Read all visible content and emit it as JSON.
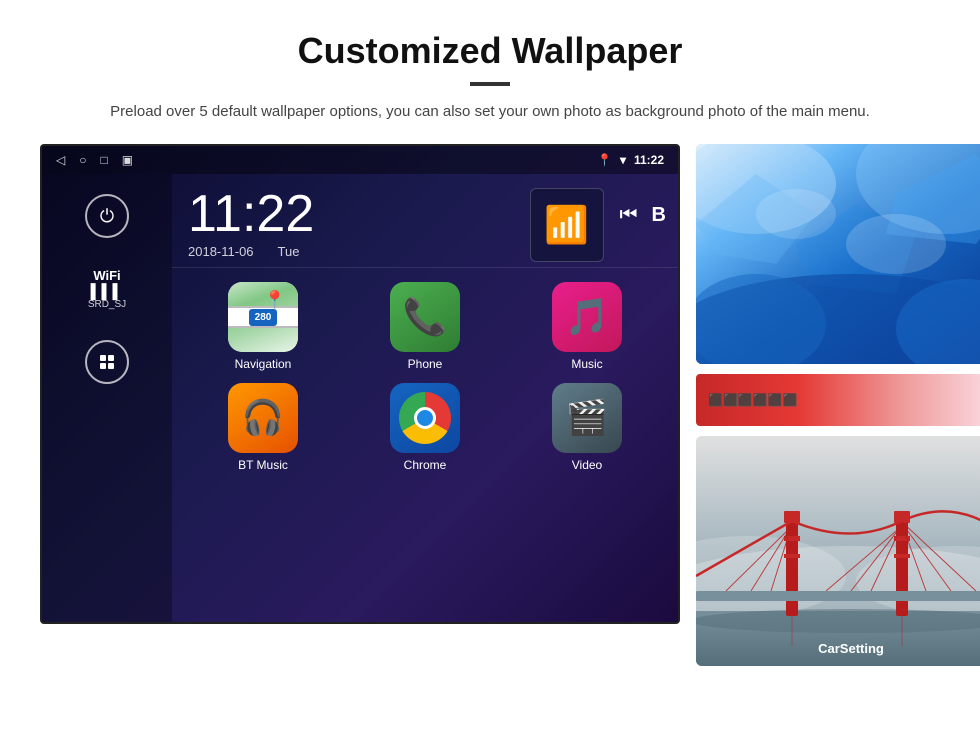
{
  "header": {
    "title": "Customized Wallpaper",
    "divider": true,
    "subtitle": "Preload over 5 default wallpaper options, you can also set your own photo as background photo of the main menu."
  },
  "android": {
    "statusBar": {
      "navBack": "◁",
      "navHome": "○",
      "navRecent": "□",
      "navCapture": "▣",
      "locationIcon": "📍",
      "wifiIcon": "▾",
      "time": "11:22"
    },
    "clock": {
      "time": "11:22",
      "date": "2018-11-06",
      "day": "Tue"
    },
    "sidebar": {
      "powerLabel": "⏻",
      "wifiLabel": "WiFi",
      "wifiBars": "▌▌▌",
      "wifiName": "SRD_SJ",
      "appsLabel": "⊞"
    },
    "apps": [
      {
        "name": "Navigation",
        "type": "navigation"
      },
      {
        "name": "Phone",
        "type": "phone"
      },
      {
        "name": "Music",
        "type": "music"
      },
      {
        "name": "BT Music",
        "type": "btmusic"
      },
      {
        "name": "Chrome",
        "type": "chrome"
      },
      {
        "name": "Video",
        "type": "video"
      }
    ],
    "mediaIcon": "wifi-signal",
    "mediaControls": {
      "prev": "⏮",
      "trackLabel": "B"
    }
  },
  "wallpapers": {
    "top": {
      "description": "Ice cave / blue abstract wallpaper"
    },
    "mid": {
      "description": "Red/pink wallpaper strip"
    },
    "bottom": {
      "description": "Golden Gate Bridge / misty bridge wallpaper",
      "label": "CarSetting"
    }
  }
}
